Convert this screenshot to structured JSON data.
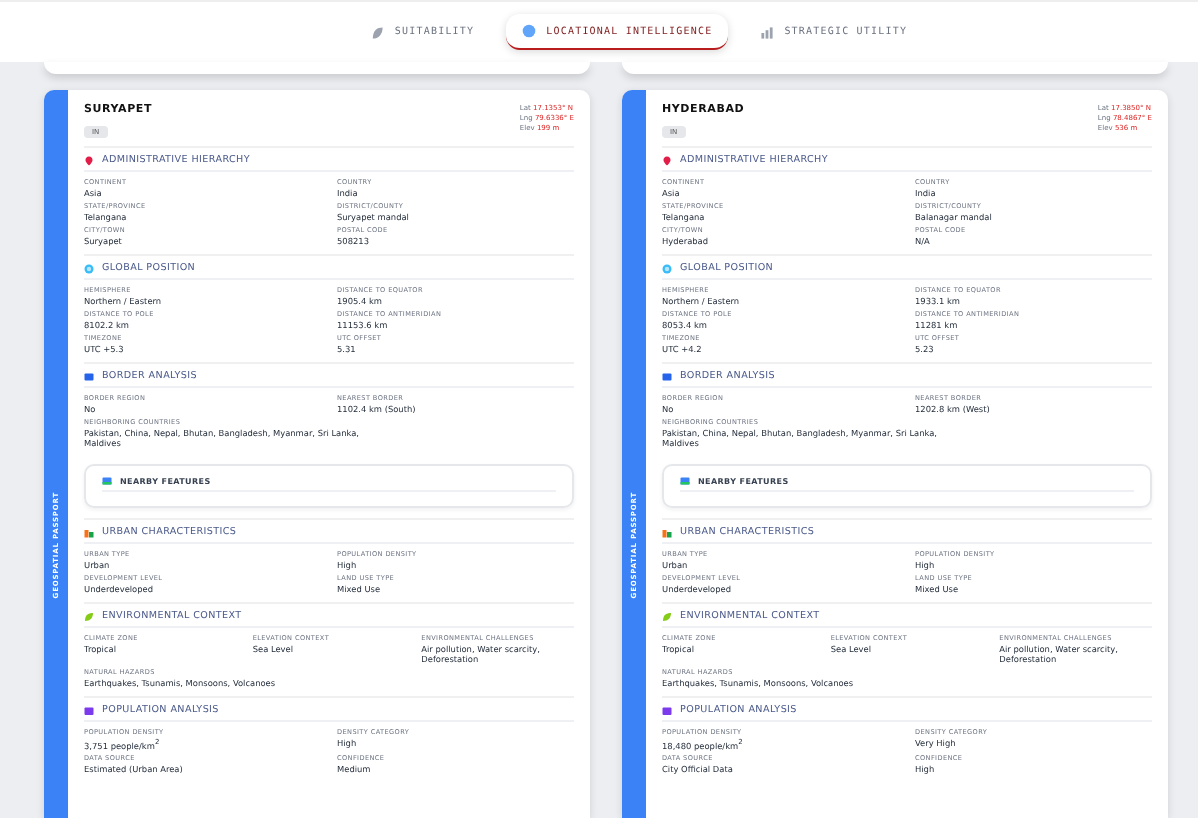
{
  "tabs": [
    {
      "label": "SUITABILITY",
      "selected": false
    },
    {
      "label": "LOCATIONAL INTELLIGENCE",
      "selected": true
    },
    {
      "label": "STRATEGIC UTILITY",
      "selected": false
    }
  ],
  "cards": [
    {
      "title": "SURYAPET",
      "badge": "IN",
      "side_label": "GEOSPATIAL PASSPORT",
      "coords": [
        {
          "label": "Lat",
          "value": "17.1353° N"
        },
        {
          "label": "Lng",
          "value": "79.6336° E"
        },
        {
          "label": "Elev",
          "value": "199 m"
        }
      ],
      "sections": [
        {
          "title": "ADMINISTRATIVE HIERARCHY",
          "kind": "fields",
          "fields": [
            {
              "label": "CONTINENT",
              "value": "Asia"
            },
            {
              "label": "COUNTRY",
              "value": "India"
            },
            {
              "label": "STATE/PROVINCE",
              "value": "Telangana"
            },
            {
              "label": "DISTRICT/COUNTY",
              "value": "Suryapet mandal"
            },
            {
              "label": "CITY/TOWN",
              "value": "Suryapet"
            },
            {
              "label": "POSTAL CODE",
              "value": "508213"
            }
          ]
        },
        {
          "title": "GLOBAL POSITION",
          "kind": "fields",
          "fields": [
            {
              "label": "HEMISPHERE",
              "value": "Northern / Eastern"
            },
            {
              "label": "DISTANCE TO EQUATOR",
              "value": "1905.4 km"
            },
            {
              "label": "DISTANCE TO POLE",
              "value": "8102.2 km"
            },
            {
              "label": "DISTANCE TO ANTIMERIDIAN",
              "value": "11153.6 km"
            },
            {
              "label": "TIMEZONE",
              "value": "UTC +5.3"
            },
            {
              "label": "UTC OFFSET",
              "value": "5.31"
            }
          ]
        },
        {
          "title": "BORDER ANALYSIS",
          "kind": "fields",
          "fields": [
            {
              "label": "BORDER REGION",
              "value": "No"
            },
            {
              "label": "NEAREST BORDER",
              "value": "1102.4 km (South)"
            },
            {
              "label": "NEIGHBORING COUNTRIES",
              "value": "Pakistan, China, Nepal, Bhutan, Bangladesh, Myanmar, Sri Lanka, Maldives",
              "wide": true
            }
          ]
        },
        {
          "title": "NEARBY FEATURES",
          "kind": "collapsed"
        },
        {
          "title": "URBAN CHARACTERISTICS",
          "kind": "fields",
          "fields": [
            {
              "label": "URBAN TYPE",
              "value": "Urban"
            },
            {
              "label": "POPULATION DENSITY",
              "value": "High"
            },
            {
              "label": "DEVELOPMENT LEVEL",
              "value": "Underdeveloped"
            },
            {
              "label": "LAND USE TYPE",
              "value": "Mixed Use"
            }
          ]
        },
        {
          "title": "ENVIRONMENTAL CONTEXT",
          "kind": "fields3",
          "fields": [
            {
              "label": "CLIMATE ZONE",
              "value": "Tropical"
            },
            {
              "label": "ELEVATION CONTEXT",
              "value": "Sea Level"
            },
            {
              "label": "ENVIRONMENTAL CHALLENGES",
              "value": "Air pollution, Water scarcity, Deforestation"
            },
            {
              "label": "NATURAL HAZARDS",
              "value": "Earthquakes, Tsunamis, Monsoons, Volcanoes",
              "wide": true
            }
          ]
        },
        {
          "title": "POPULATION ANALYSIS",
          "kind": "fields",
          "fields": [
            {
              "label": "POPULATION DENSITY",
              "value": "3,751 people/km$^{2}$"
            },
            {
              "label": "DENSITY CATEGORY",
              "value": "High"
            },
            {
              "label": "DATA SOURCE",
              "value": "Estimated (Urban Area)"
            },
            {
              "label": "CONFIDENCE",
              "value": "Medium"
            }
          ]
        }
      ]
    },
    {
      "title": "HYDERABAD",
      "badge": "IN",
      "side_label": "GEOSPATIAL PASSPORT",
      "coords": [
        {
          "label": "Lat",
          "value": "17.3850° N"
        },
        {
          "label": "Lng",
          "value": "78.4867° E"
        },
        {
          "label": "Elev",
          "value": "536 m"
        }
      ],
      "sections": [
        {
          "title": "ADMINISTRATIVE HIERARCHY",
          "kind": "fields",
          "fields": [
            {
              "label": "CONTINENT",
              "value": "Asia"
            },
            {
              "label": "COUNTRY",
              "value": "India"
            },
            {
              "label": "STATE/PROVINCE",
              "value": "Telangana"
            },
            {
              "label": "DISTRICT/COUNTY",
              "value": "Balanagar mandal"
            },
            {
              "label": "CITY/TOWN",
              "value": "Hyderabad"
            },
            {
              "label": "POSTAL CODE",
              "value": "N/A"
            }
          ]
        },
        {
          "title": "GLOBAL POSITION",
          "kind": "fields",
          "fields": [
            {
              "label": "HEMISPHERE",
              "value": "Northern / Eastern"
            },
            {
              "label": "DISTANCE TO EQUATOR",
              "value": "1933.1 km"
            },
            {
              "label": "DISTANCE TO POLE",
              "value": "8053.4 km"
            },
            {
              "label": "DISTANCE TO ANTIMERIDIAN",
              "value": "11281 km"
            },
            {
              "label": "TIMEZONE",
              "value": "UTC +4.2"
            },
            {
              "label": "UTC OFFSET",
              "value": "5.23"
            }
          ]
        },
        {
          "title": "BORDER ANALYSIS",
          "kind": "fields",
          "fields": [
            {
              "label": "BORDER REGION",
              "value": "No"
            },
            {
              "label": "NEAREST BORDER",
              "value": "1202.8 km (West)"
            },
            {
              "label": "NEIGHBORING COUNTRIES",
              "value": "Pakistan, China, Nepal, Bhutan, Bangladesh, Myanmar, Sri Lanka, Maldives",
              "wide": true
            }
          ]
        },
        {
          "title": "NEARBY FEATURES",
          "kind": "collapsed"
        },
        {
          "title": "URBAN CHARACTERISTICS",
          "kind": "fields",
          "fields": [
            {
              "label": "URBAN TYPE",
              "value": "Urban"
            },
            {
              "label": "POPULATION DENSITY",
              "value": "High"
            },
            {
              "label": "DEVELOPMENT LEVEL",
              "value": "Underdeveloped"
            },
            {
              "label": "LAND USE TYPE",
              "value": "Mixed Use"
            }
          ]
        },
        {
          "title": "ENVIRONMENTAL CONTEXT",
          "kind": "fields3",
          "fields": [
            {
              "label": "CLIMATE ZONE",
              "value": "Tropical"
            },
            {
              "label": "ELEVATION CONTEXT",
              "value": "Sea Level"
            },
            {
              "label": "ENVIRONMENTAL CHALLENGES",
              "value": "Air pollution, Water scarcity, Deforestation"
            },
            {
              "label": "NATURAL HAZARDS",
              "value": "Earthquakes, Tsunamis, Monsoons, Volcanoes",
              "wide": true
            }
          ]
        },
        {
          "title": "POPULATION ANALYSIS",
          "kind": "fields",
          "fields": [
            {
              "label": "POPULATION DENSITY",
              "value": "18,480 people/km$^{2}$"
            },
            {
              "label": "DENSITY CATEGORY",
              "value": "Very High"
            },
            {
              "label": "DATA SOURCE",
              "value": "City Official Data"
            },
            {
              "label": "CONFIDENCE",
              "value": "High"
            }
          ]
        }
      ]
    }
  ]
}
